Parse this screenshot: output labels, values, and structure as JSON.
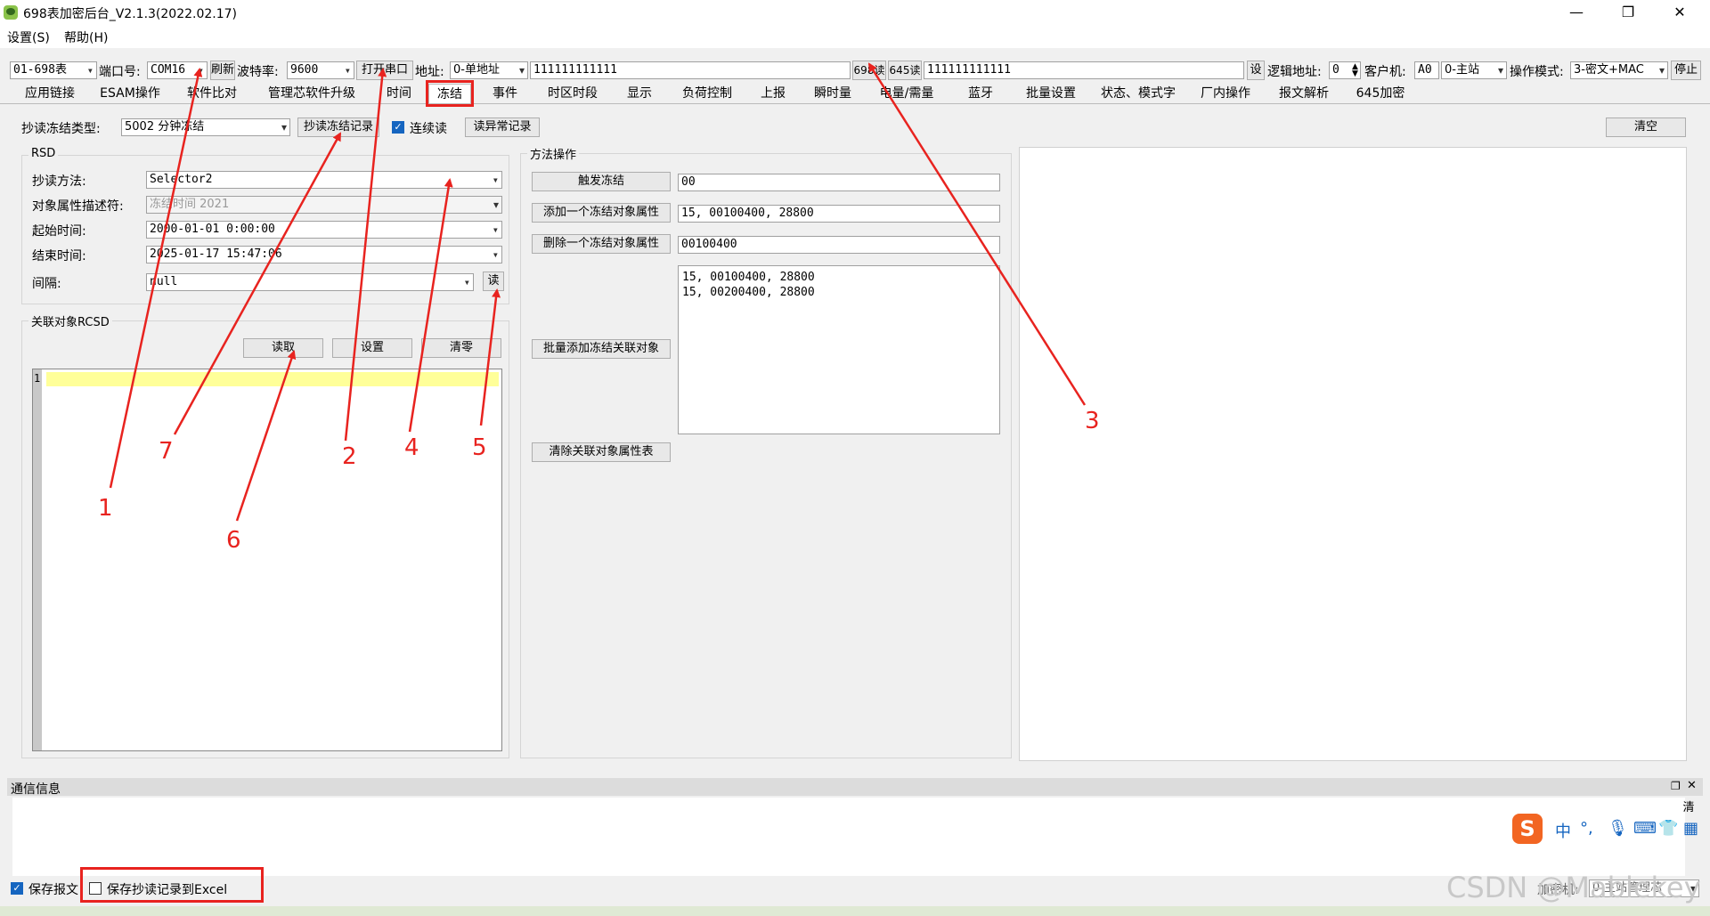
{
  "window": {
    "title": "698表加密后台_V2.1.3(2022.02.17)",
    "minimize": "—",
    "maximize": "❐",
    "close": "✕"
  },
  "menu": [
    "设置(S)",
    "帮助(H)"
  ],
  "toolbar": {
    "meter_type": "01-698表",
    "port_label": "端口号:",
    "port_value": "COM16",
    "refresh_label": "刷新",
    "baud_label": "波特率:",
    "baud_value": "9600",
    "open_port_label": "打开串口",
    "address_label": "地址:",
    "address_mode": "0-单地址",
    "address_value": "111111111111",
    "read698_label": "698读",
    "read645_label": "645读",
    "address_value_2": "111111111111",
    "set_label": "设",
    "logic_addr_label": "逻辑地址:",
    "logic_addr_value": "0",
    "client_label": "客户机:",
    "client_value": "A0",
    "master_value": "0-主站",
    "op_mode_label": "操作模式:",
    "op_mode_value": "3-密文+MAC",
    "stop_label": "停止"
  },
  "tabs": [
    "应用链接",
    "ESAM操作",
    "软件比对",
    "管理芯软件升级",
    "时间",
    "冻结",
    "事件",
    "时区时段",
    "显示",
    "负荷控制",
    "上报",
    "瞬时量",
    "电量/需量",
    "蓝牙",
    "批量设置",
    "状态、模式字",
    "厂内操作",
    "报文解析",
    "645加密"
  ],
  "active_tab": "冻结",
  "freeze": {
    "type_label": "抄读冻结类型:",
    "type_value": "5002 分钟冻结",
    "read_record_btn": "抄读冻结记录",
    "continuous_label": "连续读",
    "read_abnormal_btn": "读异常记录",
    "clear_btn": "清空"
  },
  "rsd": {
    "title": "RSD",
    "method_label": "抄读方法:",
    "method_value": "Selector2",
    "oad_label": "对象属性描述符:",
    "oad_value": "冻结时间 2021",
    "start_label": "起始时间:",
    "start_value": "2000-01-01 0:00:00",
    "end_label": "结束时间:",
    "end_value": "2025-01-17 15:47:06",
    "interval_label": "间隔:",
    "interval_value": "null",
    "read_btn": "读"
  },
  "rcsd": {
    "title": "关联对象RCSD",
    "read_btn": "读取",
    "set_btn": "设置",
    "clear_btn": "清零",
    "line_no": "1"
  },
  "method_ops": {
    "title": "方法操作",
    "trigger_btn": "触发冻结",
    "trigger_value": "00",
    "add_btn": "添加一个冻结对象属性",
    "add_value": "15, 00100400, 28800",
    "delete_btn": "删除一个冻结对象属性",
    "delete_value": "00100400",
    "batch_lines": [
      "15, 00100400, 28800",
      "15, 00200400, 28800"
    ],
    "batch_btn": "批量添加冻结关联对象",
    "clear_btn": "清除关联对象属性表"
  },
  "comm": {
    "title": "通信信息",
    "clear_label": "清"
  },
  "ime": {
    "logo": "S",
    "lang": "中",
    "punct": "°,"
  },
  "footer": {
    "save_msg_label": "保存报文",
    "save_excel_label": "保存抄读记录到Excel",
    "encryptor_label": "加密机:",
    "encryptor_value": "0-主站管理芯",
    "watermark": "CSDN @Mablekey"
  },
  "annotations": [
    "1",
    "2",
    "3",
    "4",
    "5",
    "6",
    "7"
  ],
  "colors": {
    "annotation": "#e8231f",
    "checkbox": "#1565c0",
    "highlight_line": "#ffff99"
  }
}
